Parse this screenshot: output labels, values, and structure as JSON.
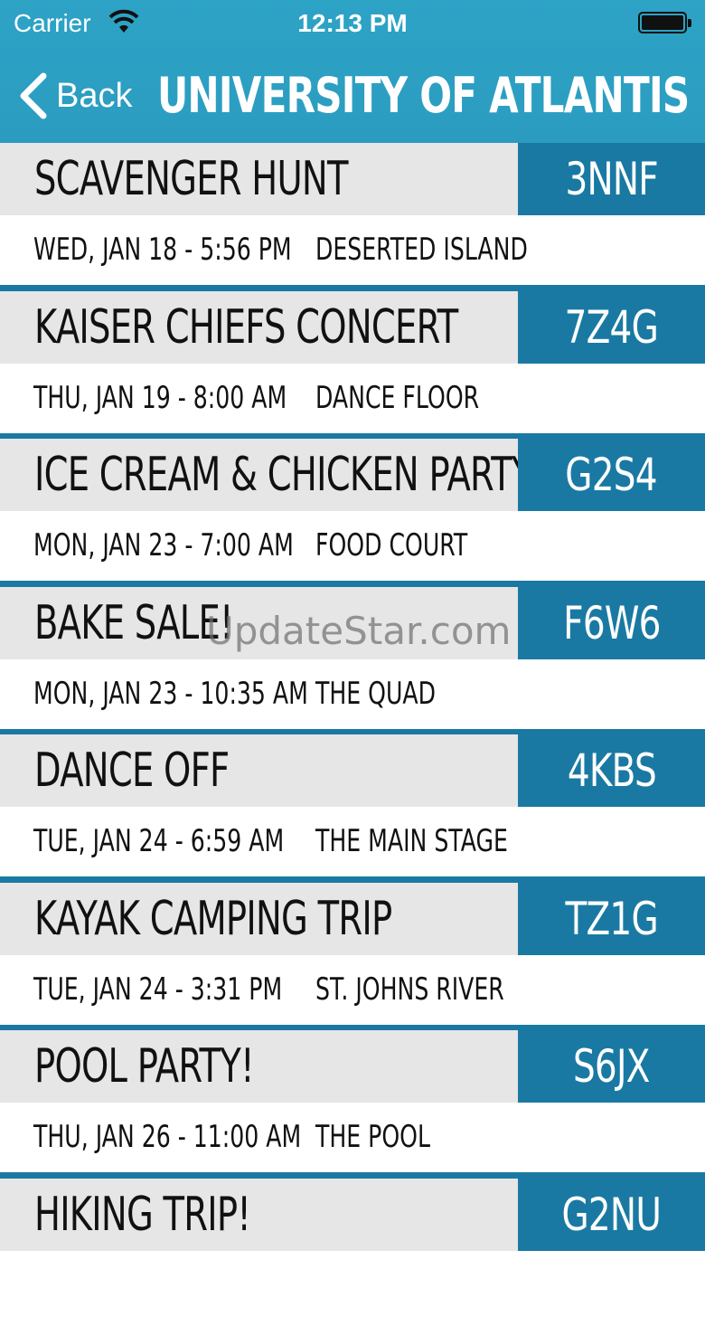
{
  "status_bar": {
    "carrier": "Carrier",
    "time": "12:13 PM"
  },
  "nav": {
    "back_label": "Back",
    "title": "UNIVERSITY OF ATLANTIS"
  },
  "colors": {
    "header": "#2ba1c4",
    "code_bg": "#1a79a3",
    "row_bg": "#e6e6e6"
  },
  "events": [
    {
      "title": "SCAVENGER HUNT",
      "code": "3NNF",
      "date": "WED, JAN 18 - 5:56 PM",
      "location": "DESERTED ISLAND"
    },
    {
      "title": "KAISER CHIEFS CONCERT",
      "code": "7Z4G",
      "date": "THU, JAN 19 - 8:00 AM",
      "location": "DANCE FLOOR"
    },
    {
      "title": "ICE CREAM & CHICKEN PARTY",
      "code": "G2S4",
      "date": "MON, JAN 23 - 7:00 AM",
      "location": "FOOD COURT"
    },
    {
      "title": "BAKE SALE!",
      "code": "F6W6",
      "date": "MON, JAN 23 - 10:35 AM",
      "location": "THE QUAD"
    },
    {
      "title": "DANCE OFF",
      "code": "4KBS",
      "date": "TUE, JAN 24 - 6:59 AM",
      "location": "THE MAIN STAGE"
    },
    {
      "title": "KAYAK CAMPING TRIP",
      "code": "TZ1G",
      "date": "TUE, JAN 24 - 3:31 PM",
      "location": "ST. JOHNS RIVER"
    },
    {
      "title": "POOL PARTY!",
      "code": "S6JX",
      "date": "THU, JAN 26 - 11:00 AM",
      "location": "THE POOL"
    },
    {
      "title": "HIKING TRIP!",
      "code": "G2NU",
      "date": "",
      "location": ""
    }
  ],
  "watermark": "UpdateStar.com"
}
